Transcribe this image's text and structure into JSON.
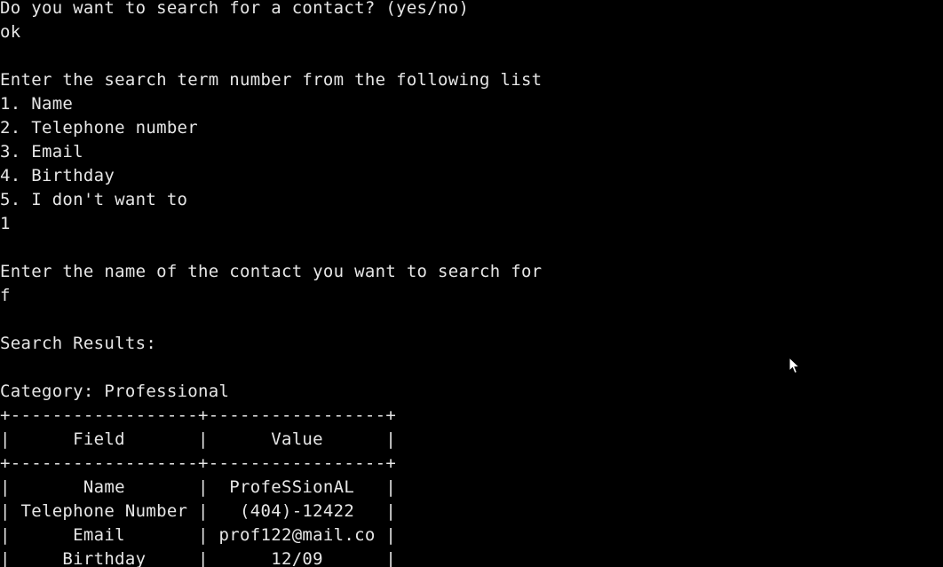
{
  "terminal": {
    "lines": [
      "Do you want to search for a contact? (yes/no)",
      "ok",
      "",
      "Enter the search term number from the following list",
      "1. Name",
      "2. Telephone number",
      "3. Email",
      "4. Birthday",
      "5. I don't want to",
      "1",
      "",
      "Enter the name of the contact you want to search for",
      "f",
      "",
      "Search Results:",
      "",
      "Category: Professional",
      "+------------------+-----------------+",
      "|      Field       |      Value      |",
      "+------------------+-----------------+",
      "|       Name       |  ProfeSSionAL   |",
      "| Telephone Number |   (404)-12422   |",
      "|      Email       | prof122@mail.co |",
      "|     Birthday     |      12/09      |"
    ]
  },
  "colors": {
    "background": "#000000",
    "text": "#e6e6e6"
  },
  "icons": {
    "pointer": "mouse-pointer-icon"
  }
}
